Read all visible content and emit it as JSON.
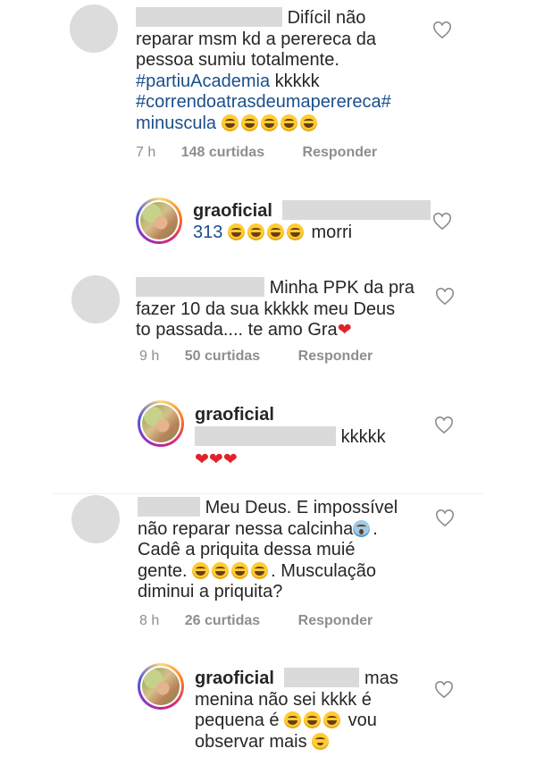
{
  "comments": [
    {
      "line1_text": "Difícil não",
      "line2": "reparar msm kd a perereca da",
      "line3": "pessoa sumiu totalmente.",
      "hashtag1": "#partiuAcademia",
      "after_hashtag1": "kkkkk",
      "hashtag2a": "#correndoatrasdeumaperereca#",
      "hashtag2b": "minuscula",
      "time": "7 h",
      "likes": "148 curtidas",
      "reply": "Responder"
    },
    {
      "username": "graoficial",
      "mention": "313",
      "text": "morri"
    },
    {
      "line1_text": "Minha PPK da pra",
      "line2": "fazer 10 da sua kkkkk meu Deus",
      "line3": "to passada.... te amo Gra",
      "time": "9 h",
      "likes": "50 curtidas",
      "reply": "Responder"
    },
    {
      "username": "graoficial",
      "text": "kkkkk"
    },
    {
      "line1_text": "Meu Deus. E impossível",
      "line2": "não reparar nessa calcinha",
      "line2_end": ".",
      "line3": "Cadê a priquita dessa muié",
      "line4a": "gente.",
      "line4b": ". Musculação",
      "line5": "diminui a priquita?",
      "time": "8 h",
      "likes": "26 curtidas",
      "reply": "Responder"
    },
    {
      "username": "graoficial",
      "line1_end": "mas",
      "line2": "menina não sei kkkk é",
      "line3a": "pequena é",
      "line3b": "vou",
      "line4": "observar mais"
    }
  ],
  "icons": {
    "like": "heart-outline-icon",
    "laugh": "grinning-sweat-emoji",
    "scream": "screaming-face-emoji",
    "wink": "winking-face-emoji",
    "heart": "red-heart-emoji"
  },
  "colors": {
    "hashtag": "#1a4f8b",
    "meta": "#8e8e8e",
    "redaction": "#dadada",
    "heart": "#e0222b"
  }
}
